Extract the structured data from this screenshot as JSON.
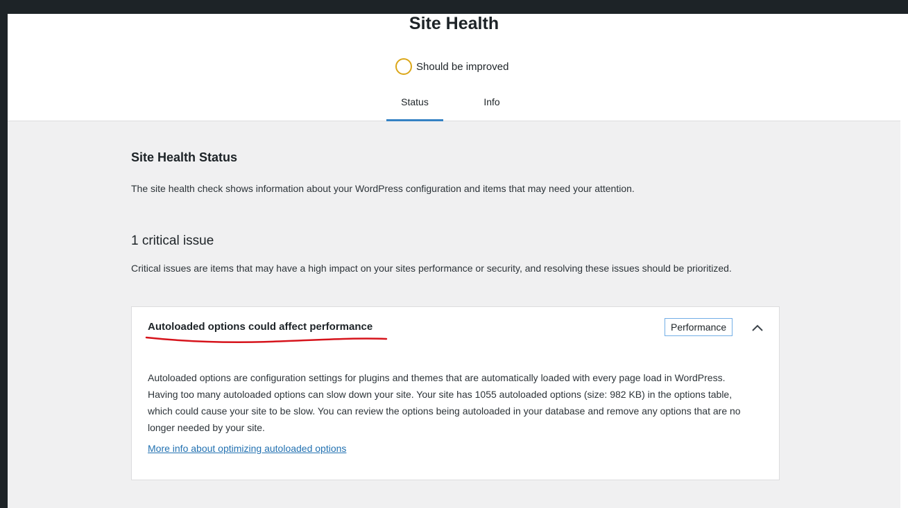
{
  "page": {
    "title": "Site Health",
    "status_text": "Should be improved",
    "status_color": "#dba617",
    "tabs": [
      {
        "label": "Status",
        "active": true
      },
      {
        "label": "Info",
        "active": false
      }
    ]
  },
  "main": {
    "heading": "Site Health Status",
    "description": "The site health check shows information about your WordPress configuration and items that may need your attention.",
    "issues_heading": "1 critical issue",
    "issues_description": "Critical issues are items that may have a high impact on your sites performance or security, and resolving these issues should be prioritized."
  },
  "issue": {
    "title": "Autoloaded options could affect performance",
    "badge": "Performance",
    "toggle_icon": "chevron-up-icon",
    "body": "Autoloaded options are configuration settings for plugins and themes that are automatically loaded with every page load in WordPress. Having too many autoloaded options can slow down your site. Your site has 1055 autoloaded options (size: 982 KB) in the options table, which could cause your site to be slow. You can review the options being autoloaded in your database and remove any options that are no longer needed by your site.",
    "link": "More info about optimizing autoloaded options",
    "annotation_color": "#d6131b"
  }
}
